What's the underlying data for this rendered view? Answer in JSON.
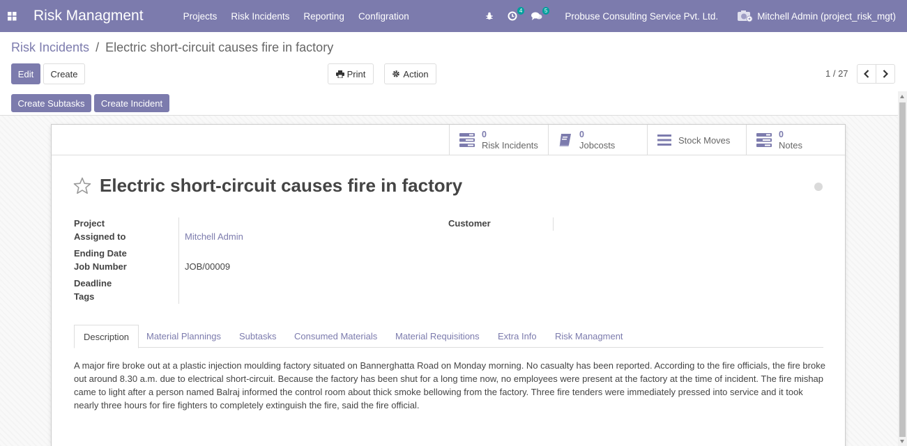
{
  "navbar": {
    "app_title": "Risk Managment",
    "menu": [
      "Projects",
      "Risk Incidents",
      "Reporting",
      "Configration"
    ],
    "activity_count": "4",
    "messages_count": "5",
    "company": "Probuse Consulting Service Pvt. Ltd.",
    "user": "Mitchell Admin (project_risk_mgt)",
    "bg_color": "#7c7bad"
  },
  "breadcrumb": {
    "parent": "Risk Incidents",
    "separator": "/",
    "current": "Electric short-circuit causes fire in factory"
  },
  "control": {
    "edit_label": "Edit",
    "create_label": "Create",
    "print_label": "Print",
    "action_label": "Action",
    "pager": "1 / 27"
  },
  "header_buttons": {
    "create_subtasks": "Create Subtasks",
    "create_incident": "Create Incident"
  },
  "smart_buttons": [
    {
      "value": "0",
      "label": "Risk Incidents",
      "icon": "tasks-icon"
    },
    {
      "value": "0",
      "label": "Jobcosts",
      "icon": "book-icon"
    },
    {
      "value": "",
      "label": "Stock Moves",
      "icon": "list-icon"
    },
    {
      "value": "0",
      "label": "Notes",
      "icon": "tasks-icon"
    }
  ],
  "record": {
    "title": "Electric short-circuit causes fire in factory",
    "fields": {
      "project_label": "Project",
      "project_value": "",
      "assigned_label": "Assigned to",
      "assigned_value": "Mitchell Admin",
      "ending_date_label": "Ending Date",
      "ending_date_value": "",
      "job_number_label": "Job Number",
      "job_number_value": "JOB/00009",
      "deadline_label": "Deadline",
      "deadline_value": "",
      "tags_label": "Tags",
      "tags_value": "",
      "customer_label": "Customer",
      "customer_value": ""
    }
  },
  "tabs": [
    "Description",
    "Material Plannings",
    "Subtasks",
    "Consumed Materials",
    "Material Requisitions",
    "Extra Info",
    "Risk Managment"
  ],
  "active_tab": "Description",
  "description": "A major fire broke out at a plastic injection moulding factory situated on Bannerghatta Road on Monday morning. No casualty has been reported. According to the fire officials, the fire broke out around 8.30 a.m. due to electrical short-circuit. Because the factory has been shut for a long time now, no employees were present at the factory at the time of incident. The fire mishap came to light after a person named Balraj informed the control room about thick smoke bellowing from the factory. Three fire tenders were immediately pressed into service and it took nearly three hours for fire fighters to completely extinguish the fire, said the fire official."
}
